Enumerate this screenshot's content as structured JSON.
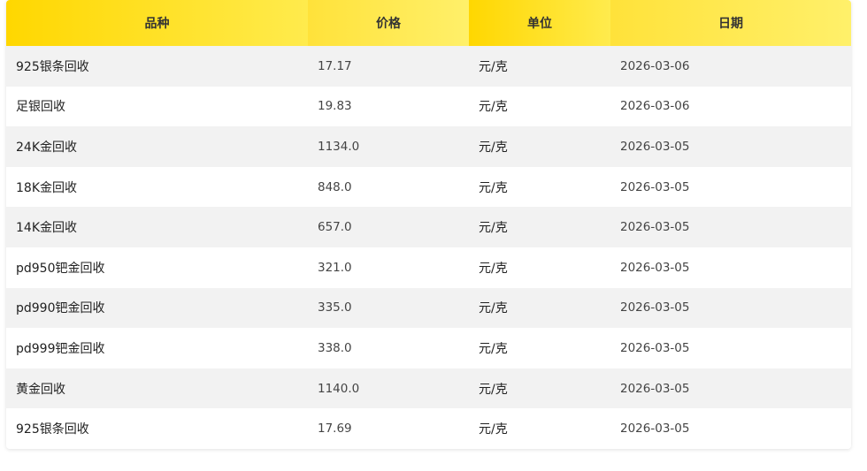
{
  "headers": [
    "品种",
    "价格",
    "单位",
    "日期"
  ],
  "rows": [
    {
      "item": "925银条回收",
      "price": "17.17",
      "unit": "元/克",
      "date": "2026-03-06"
    },
    {
      "item": "足银回收",
      "price": "19.83",
      "unit": "元/克",
      "date": "2026-03-06"
    },
    {
      "item": "24K金回收",
      "price": "1134.0",
      "unit": "元/克",
      "date": "2026-03-05"
    },
    {
      "item": "18K金回收",
      "price": "848.0",
      "unit": "元/克",
      "date": "2026-03-05"
    },
    {
      "item": "14K金回收",
      "price": "657.0",
      "unit": "元/克",
      "date": "2026-03-05"
    },
    {
      "item": "pd950钯金回收",
      "price": "321.0",
      "unit": "元/克",
      "date": "2026-03-05"
    },
    {
      "item": "pd990钯金回收",
      "price": "335.0",
      "unit": "元/克",
      "date": "2026-03-05"
    },
    {
      "item": "pd999钯金回收",
      "price": "338.0",
      "unit": "元/克",
      "date": "2026-03-05"
    },
    {
      "item": "黄金回收",
      "price": "1140.0",
      "unit": "元/克",
      "date": "2026-03-05"
    },
    {
      "item": "925银条回收",
      "price": "17.69",
      "unit": "元/克",
      "date": "2026-03-05"
    }
  ]
}
